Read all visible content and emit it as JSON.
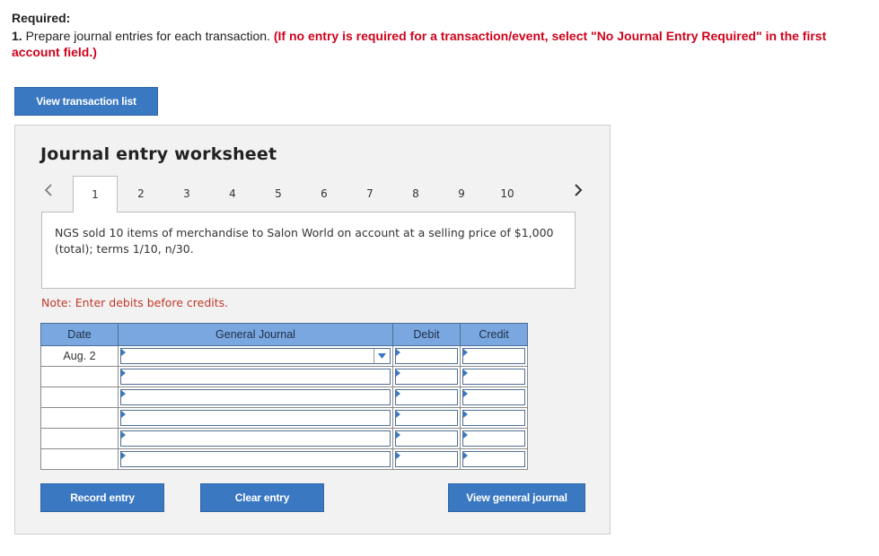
{
  "required": {
    "title": "Required:",
    "item_number": "1.",
    "instruction": " Prepare journal entries for each transaction. ",
    "red_note": "(If no entry is required for a transaction/event, select \"No Journal Entry Required\" in the first account field.)"
  },
  "buttons": {
    "view_transaction_list": "View transaction list",
    "record_entry": "Record entry",
    "clear_entry": "Clear entry",
    "view_general_journal": "View general journal"
  },
  "worksheet": {
    "title": "Journal entry worksheet",
    "tabs": [
      "1",
      "2",
      "3",
      "4",
      "5",
      "6",
      "7",
      "8",
      "9",
      "10"
    ],
    "active_tab": "1",
    "description": "NGS sold 10 items of merchandise to Salon World on account at a selling price of $1,000 (total); terms 1/10, n/30.",
    "note": "Note: Enter debits before credits."
  },
  "journal": {
    "headers": {
      "date": "Date",
      "general_journal": "General Journal",
      "debit": "Debit",
      "credit": "Credit"
    },
    "rows": [
      {
        "date": "Aug. 2",
        "account": "",
        "debit": "",
        "credit": ""
      },
      {
        "date": "",
        "account": "",
        "debit": "",
        "credit": ""
      },
      {
        "date": "",
        "account": "",
        "debit": "",
        "credit": ""
      },
      {
        "date": "",
        "account": "",
        "debit": "",
        "credit": ""
      },
      {
        "date": "",
        "account": "",
        "debit": "",
        "credit": ""
      },
      {
        "date": "",
        "account": "",
        "debit": "",
        "credit": ""
      }
    ]
  },
  "colors": {
    "button_blue": "#3a78c2",
    "header_blue": "#7aa7e0",
    "required_red": "#d0021b",
    "note_red": "#c0392b"
  },
  "icons": {
    "prev": "chevron-left-icon",
    "next": "chevron-right-icon",
    "dropdown": "caret-down-icon"
  }
}
